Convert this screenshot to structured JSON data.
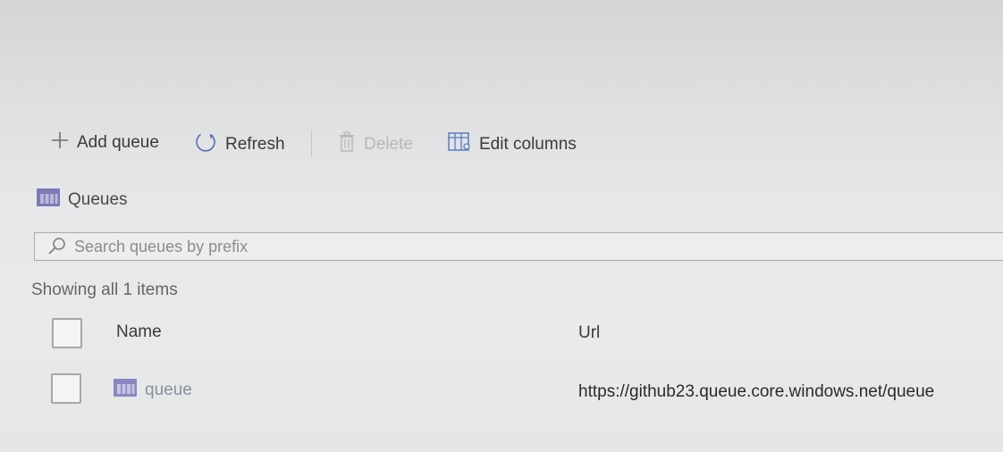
{
  "toolbar": {
    "add_queue_label": "Add queue",
    "refresh_label": "Refresh",
    "delete_label": "Delete",
    "edit_columns_label": "Edit columns"
  },
  "heading": {
    "title": "Queues"
  },
  "search": {
    "placeholder": "Search queues by prefix",
    "value": ""
  },
  "status": {
    "text": "Showing all 1 items"
  },
  "table": {
    "columns": [
      "Name",
      "Url"
    ],
    "rows": [
      {
        "name": "queue",
        "url": "https://github23.queue.core.windows.net/queue"
      }
    ]
  },
  "colors": {
    "accent": "#6b6ba8",
    "disabled": "#b8b8b8",
    "text": "#3b3a39"
  },
  "icons": {
    "add": "plus-icon",
    "refresh": "refresh-icon",
    "delete": "trash-icon",
    "edit_columns": "edit-columns-icon",
    "queue": "queue-icon",
    "search": "search-icon"
  }
}
